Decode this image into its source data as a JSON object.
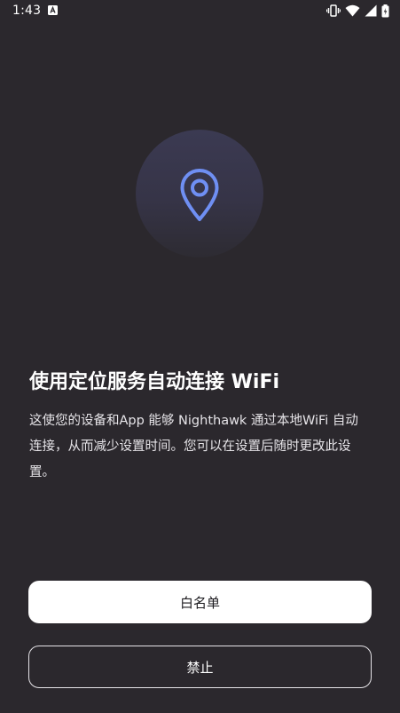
{
  "status_bar": {
    "time": "1:43",
    "notification_icon": "accessibility-a-icon",
    "icons": [
      "vibrate-icon",
      "wifi-icon",
      "signal-icon",
      "battery-icon"
    ]
  },
  "hero": {
    "icon": "location-pin-icon",
    "accent_color": "#6f8ff3"
  },
  "title": "使用定位服务自动连接 WiFi",
  "description": "这使您的设备和App 能够 Nighthawk 通过本地WiFi 自动连接，从而减少设置时间。您可以在设置后随时更改此设置。",
  "buttons": {
    "allow_label": "白名单",
    "deny_label": "禁止"
  }
}
